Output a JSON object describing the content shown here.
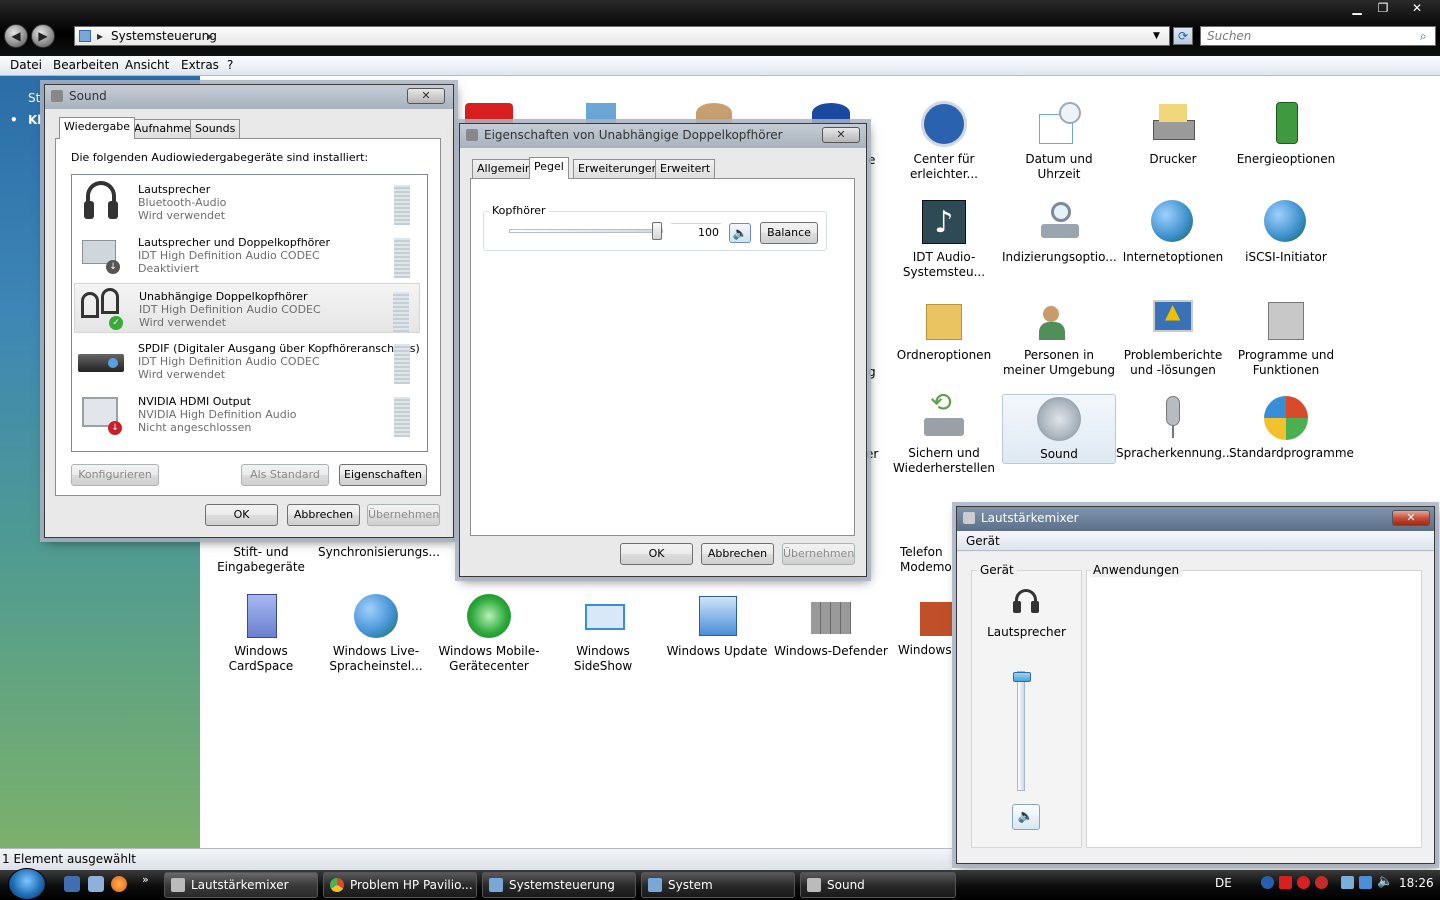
{
  "explorer": {
    "address": "Systemsteuerung",
    "search_placeholder": "Suchen",
    "menu": [
      "Datei",
      "Bearbeiten",
      "Ansicht",
      "Extras",
      "?"
    ],
    "left_fragments": [
      "St",
      "Kl"
    ],
    "status": "1 Element ausgewählt",
    "icons": [
      {
        "label": "Center für erleichter...",
        "color": "#2a62b0"
      },
      {
        "label": "Datum und Uhrzeit",
        "color": "#6ea7d8"
      },
      {
        "label": "Drucker",
        "color": "#9a9a9a"
      },
      {
        "label": "Energieoptionen",
        "color": "#3f9a3f"
      },
      {
        "label": "IDT Audio-Systemsteu...",
        "color": "#2d4a55"
      },
      {
        "label": "Indizierungsoptio...",
        "color": "#9aa5b0"
      },
      {
        "label": "Internetoptionen",
        "color": "#3a8ec9"
      },
      {
        "label": "iSCSI-Initiator",
        "color": "#3a8ec9"
      },
      {
        "label": "Ordneroptionen",
        "color": "#e9c460"
      },
      {
        "label": "Personen in meiner Umgebung",
        "color": "#4f8f5a"
      },
      {
        "label": "Problemberichte und -lösungen",
        "color": "#3a72b8"
      },
      {
        "label": "Programme und Funktionen",
        "color": "#8a8a8a"
      },
      {
        "label": "Sichern und Wiederherstellen",
        "color": "#5aa14a"
      },
      {
        "label": "Sound",
        "color": "#a9b3bd"
      },
      {
        "label": "Spracherkennung...",
        "color": "#b8bcc0"
      },
      {
        "label": "Standardprogramme",
        "color": "#d94a2a"
      },
      {
        "label": "Stift- und Eingabegeräte",
        "color": "#6a6a6a"
      },
      {
        "label": "Synchronisierungs...",
        "color": "#4caf50"
      },
      {
        "label": "Telefon Modemo",
        "color": "#8a8a8a"
      },
      {
        "label": "Windows CardSpace",
        "color": "#6b7fd0"
      },
      {
        "label": "Windows Live-Spracheinstel...",
        "color": "#3f8fd0"
      },
      {
        "label": "Windows Mobile-Gerätecenter",
        "color": "#2eaa3c"
      },
      {
        "label": "Windows SideShow",
        "color": "#3a8ed8"
      },
      {
        "label": "Windows Update",
        "color": "#4a8fd8"
      },
      {
        "label": "Windows-Defender",
        "color": "#7a7a7a"
      },
      {
        "label": "Windows-",
        "color": "#c0502a"
      }
    ],
    "partial_labels": [
      "e",
      "g",
      "er"
    ]
  },
  "sound_dialog": {
    "title": "Sound",
    "tabs": [
      "Wiedergabe",
      "Aufnahme",
      "Sounds"
    ],
    "intro": "Die folgenden Audiowiedergabegeräte sind installiert:",
    "devices": [
      {
        "name": "Lautsprecher",
        "driver": "Bluetooth-Audio",
        "state": "Wird verwendet"
      },
      {
        "name": "Lautsprecher und Doppelkopfhörer",
        "driver": "IDT High Definition Audio CODEC",
        "state": "Deaktiviert"
      },
      {
        "name": "Unabhängige Doppelkopfhörer",
        "driver": "IDT High Definition Audio CODEC",
        "state": "Wird verwendet"
      },
      {
        "name": "SPDIF (Digitaler Ausgang über Kopfhöreranschluss)",
        "driver": "IDT High Definition Audio CODEC",
        "state": "Wird verwendet"
      },
      {
        "name": "NVIDIA HDMI Output",
        "driver": "NVIDIA High Definition Audio",
        "state": "Nicht angeschlossen"
      }
    ],
    "btn_configure": "Konfigurieren",
    "btn_default": "Als Standard",
    "btn_properties": "Eigenschaften",
    "btn_ok": "OK",
    "btn_cancel": "Abbrechen",
    "btn_apply": "Übernehmen"
  },
  "props_dialog": {
    "title": "Eigenschaften von Unabhängige Doppelkopfhörer",
    "tabs": [
      "Allgemein",
      "Pegel",
      "Erweiterungen",
      "Erweitert"
    ],
    "group": "Kopfhörer",
    "level": "100",
    "level_fraction": 1.0,
    "btn_balance": "Balance",
    "btn_ok": "OK",
    "btn_cancel": "Abbrechen",
    "btn_apply": "Übernehmen"
  },
  "mixer": {
    "title": "Lautstärkemixer",
    "menu_device": "Gerät",
    "device_group": "Gerät",
    "device_name": "Lautsprecher",
    "apps_group": "Anwendungen",
    "volume_fraction": 1.0
  },
  "taskbar": {
    "items": [
      "Lautstärkemixer",
      "Problem HP Pavilio...",
      "Systemsteuerung",
      "System",
      "Sound"
    ],
    "lang": "DE",
    "time": "18:26"
  }
}
